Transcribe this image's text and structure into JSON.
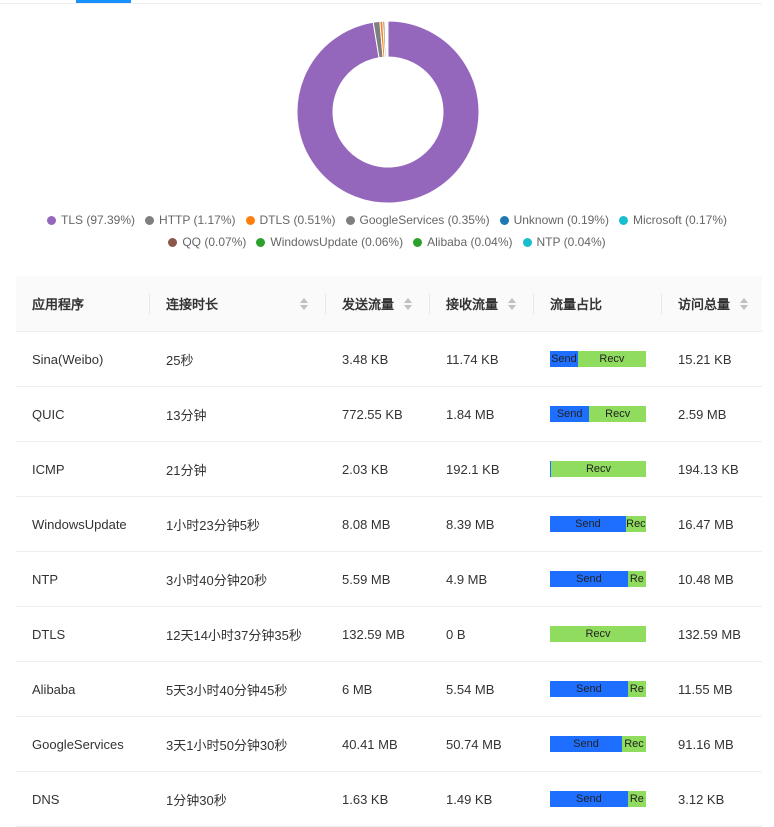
{
  "colors": {
    "accent": "#1890ff",
    "send": "#1e6fff",
    "recv": "#8fdc5e"
  },
  "chart_data": {
    "type": "pie",
    "donut": true,
    "categories": [
      "TLS",
      "HTTP",
      "DTLS",
      "GoogleServices",
      "Unknown",
      "Microsoft",
      "QQ",
      "WindowsUpdate",
      "Alibaba",
      "NTP"
    ],
    "values": [
      97.39,
      1.17,
      0.51,
      0.35,
      0.19,
      0.17,
      0.07,
      0.06,
      0.04,
      0.04
    ],
    "colors": [
      "#9467bd",
      "#7f7f7f",
      "#ff7f0e",
      "#7f7f7f",
      "#1f77b4",
      "#17becf",
      "#8c564b",
      "#2ca02c",
      "#2ca02c",
      "#17becf"
    ],
    "legend_labels": [
      "TLS (97.39%)",
      "HTTP (1.17%)",
      "DTLS (0.51%)",
      "GoogleServices (0.35%)",
      "Unknown (0.19%)",
      "Microsoft (0.17%)",
      "QQ (0.07%)",
      "WindowsUpdate (0.06%)",
      "Alibaba (0.04%)",
      "NTP (0.04%)"
    ],
    "legend": "bottom"
  },
  "table": {
    "headers": [
      "应用程序",
      "连接时长",
      "发送流量",
      "接收流量",
      "流量占比",
      "访问总量"
    ],
    "bar_labels": {
      "send": "Send",
      "recv": "Recv"
    },
    "rows": [
      {
        "app": "Sina(Weibo)",
        "duration": "25秒",
        "sent": "3.48 KB",
        "recv": "11.74 KB",
        "send_frac": 0.29,
        "send_text": "Send",
        "recv_text": "Recv",
        "total": "15.21 KB"
      },
      {
        "app": "QUIC",
        "duration": "13分钟",
        "sent": "772.55 KB",
        "recv": "1.84 MB",
        "send_frac": 0.41,
        "send_text": "Send",
        "recv_text": "Recv",
        "total": "2.59 MB"
      },
      {
        "app": "ICMP",
        "duration": "21分钟",
        "sent": "2.03 KB",
        "recv": "192.1 KB",
        "send_frac": 0.01,
        "send_text": "",
        "recv_text": "Recv",
        "total": "194.13 KB"
      },
      {
        "app": "WindowsUpdate",
        "duration": "1小时23分钟5秒",
        "sent": "8.08 MB",
        "recv": "8.39 MB",
        "send_frac": 0.79,
        "send_text": "Send",
        "recv_text": "Rec",
        "total": "16.47 MB"
      },
      {
        "app": "NTP",
        "duration": "3小时40分钟20秒",
        "sent": "5.59 MB",
        "recv": "4.9 MB",
        "send_frac": 0.81,
        "send_text": "Send",
        "recv_text": "Re",
        "total": "10.48 MB"
      },
      {
        "app": "DTLS",
        "duration": "12天14小时37分钟35秒",
        "sent": "132.59 MB",
        "recv": "0 B",
        "send_frac": 0.0,
        "send_text": "",
        "recv_text": "Recv",
        "total": "132.59 MB"
      },
      {
        "app": "Alibaba",
        "duration": "5天3小时40分钟45秒",
        "sent": "6 MB",
        "recv": "5.54 MB",
        "send_frac": 0.81,
        "send_text": "Send",
        "recv_text": "Re",
        "total": "11.55 MB"
      },
      {
        "app": "GoogleServices",
        "duration": "3天1小时50分钟30秒",
        "sent": "40.41 MB",
        "recv": "50.74 MB",
        "send_frac": 0.75,
        "send_text": "Send",
        "recv_text": "Rec",
        "total": "91.16 MB"
      },
      {
        "app": "DNS",
        "duration": "1分钟30秒",
        "sent": "1.63 KB",
        "recv": "1.49 KB",
        "send_frac": 0.81,
        "send_text": "Send",
        "recv_text": "Re",
        "total": "3.12 KB"
      }
    ]
  }
}
